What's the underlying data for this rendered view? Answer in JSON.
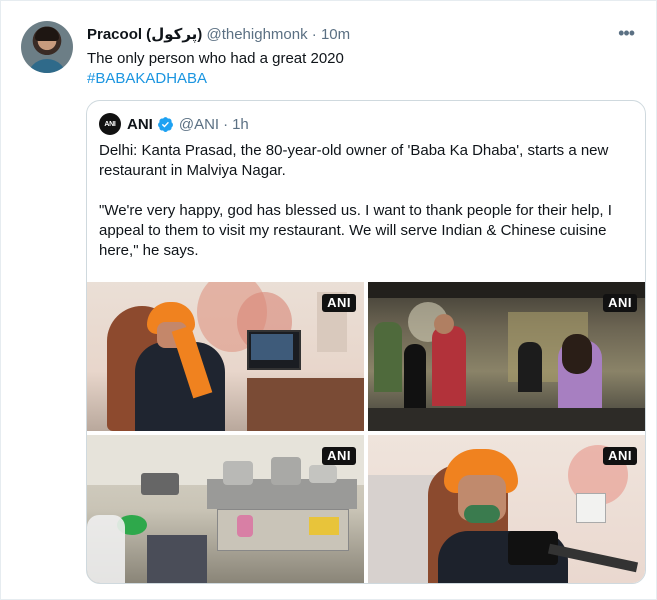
{
  "tweet": {
    "author_name": "Pracool (پرکول)",
    "handle": "@thehighmonk",
    "separator": "·",
    "time": "10m",
    "more_icon": "more-horizontal-icon",
    "text": "The only person who had a great 2020",
    "hashtag": "#BABAKADHABA"
  },
  "quote": {
    "logo_text": "ANI",
    "author_name": "ANI",
    "verified_icon": "verified-badge-icon",
    "handle": "@ANI",
    "separator": "·",
    "time": "1h",
    "paragraph1": "Delhi: Kanta Prasad, the 80-year-old owner of 'Baba Ka Dhaba', starts a new restaurant in Malviya Nagar.",
    "paragraph2": "\"We're very happy, god has blessed us. I want to thank people for their help, I appeal to them to visit my restaurant. We will serve Indian & Chinese cuisine here,\" he says.",
    "photo_badges": [
      "ANI",
      "ANI",
      "ANI",
      "ANI"
    ]
  },
  "colors": {
    "link": "#1b95e0",
    "secondary_text": "#5b7083",
    "border": "#cfd9de",
    "verified": "#1da1f2"
  }
}
